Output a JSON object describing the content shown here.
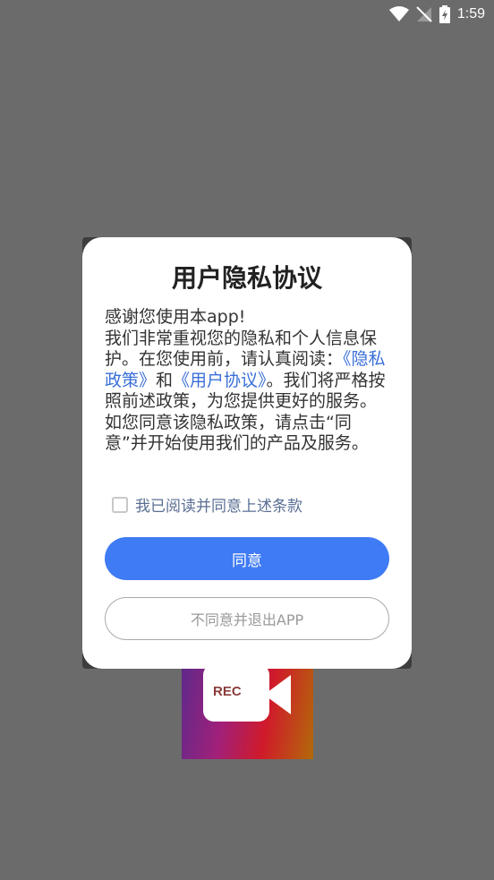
{
  "status_bar": {
    "time": "1:59",
    "icons": [
      "wifi-icon",
      "signal-icon",
      "battery-icon"
    ]
  },
  "splash": {
    "logo_text": "REC"
  },
  "dialog": {
    "title": "用户隐私协议",
    "body": {
      "line1": "感谢您使用本app!",
      "intro": "我们非常重视您的隐私和个人信息保护。在您使用前，请认真阅读：",
      "privacy_link": "《隐私政策》",
      "and_text": "和",
      "user_link": "《用户协议》",
      "rest": "。我们将严格按照前述政策，为您提供更好的服务。如您同意该隐私政策，请点击“同意”并开始使用我们的产品及服务。"
    },
    "checkbox_label": "我已阅读并同意上述条款",
    "checkbox_checked": false,
    "agree_button": "同意",
    "decline_button": "不同意并退出APP"
  },
  "colors": {
    "primary": "#3f7bf5",
    "link": "#3a6fd8",
    "overlay": "#6b6b6b"
  }
}
